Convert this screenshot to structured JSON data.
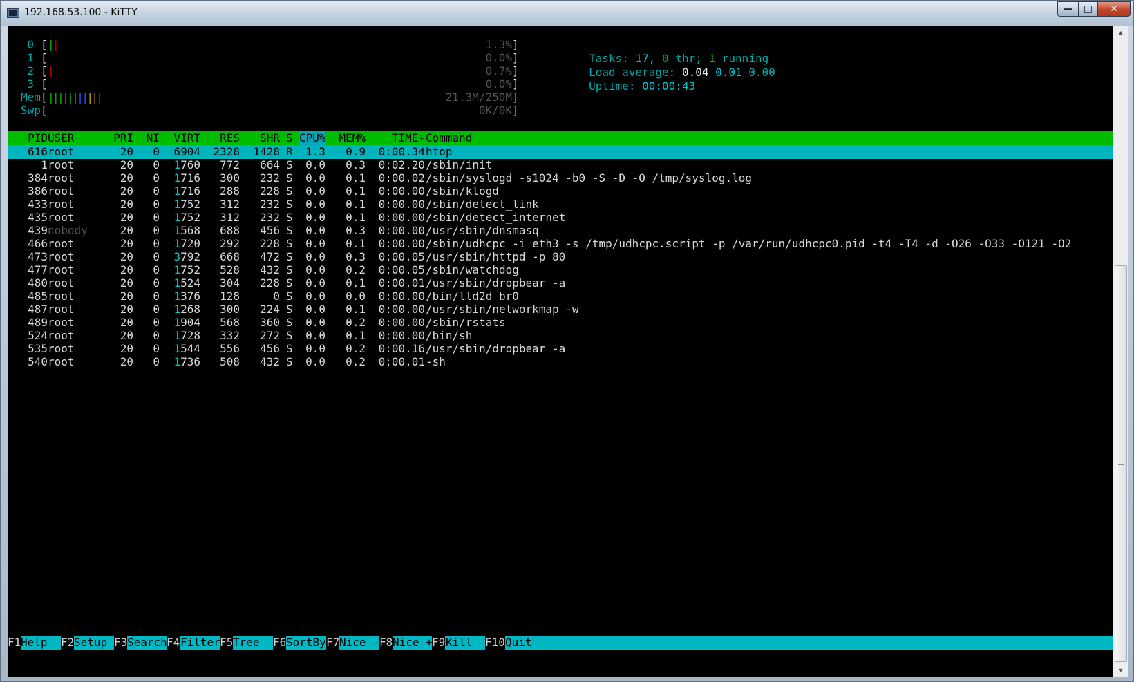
{
  "window": {
    "title": "192.168.53.100 - KiTTY"
  },
  "meters": {
    "cpus": [
      {
        "label": "0",
        "percent": "1.3%",
        "bars": [
          {
            "ch": "|",
            "color": "green"
          },
          {
            "ch": "|",
            "color": "red"
          }
        ]
      },
      {
        "label": "1",
        "percent": "0.0%",
        "bars": []
      },
      {
        "label": "2",
        "percent": "0.7%",
        "bars": [
          {
            "ch": "|",
            "color": "red"
          }
        ]
      },
      {
        "label": "3",
        "percent": "0.0%",
        "bars": []
      }
    ],
    "mem": {
      "label": "Mem",
      "value": "21.3M/250M"
    },
    "swp": {
      "label": "Swp",
      "value": "0K/0K"
    }
  },
  "summary": {
    "tasks_label": "Tasks:",
    "tasks_count": "17,",
    "threads_count": "0",
    "threads_label": "thr;",
    "running_count": "1",
    "running_label": "running",
    "load_label": "Load average:",
    "load_1": "0.04",
    "load_5": "0.01",
    "load_15": "0.00",
    "uptime_label": "Uptime:",
    "uptime_value": "00:00:43"
  },
  "table": {
    "columns": {
      "pid": "PID",
      "user": "USER",
      "pri": "PRI",
      "ni": "NI",
      "virt": "VIRT",
      "res": "RES",
      "shr": "SHR",
      "s": "S",
      "cpu": "CPU%",
      "mem": "MEM%",
      "time": "TIME+",
      "command": "Command"
    },
    "rows": [
      {
        "pid": "616",
        "user": "root",
        "pri": "20",
        "ni": "0",
        "virt": "6904",
        "res": "2328",
        "shr": "1428",
        "s": "R",
        "cpu": "1.3",
        "mem": "0.9",
        "time": "0:00.34",
        "command": "htop",
        "selected": true
      },
      {
        "pid": "1",
        "user": "root",
        "pri": "20",
        "ni": "0",
        "virt": "1760",
        "res": "772",
        "shr": "664",
        "s": "S",
        "cpu": "0.0",
        "mem": "0.3",
        "time": "0:02.20",
        "command": "/sbin/init"
      },
      {
        "pid": "384",
        "user": "root",
        "pri": "20",
        "ni": "0",
        "virt": "1716",
        "res": "300",
        "shr": "232",
        "s": "S",
        "cpu": "0.0",
        "mem": "0.1",
        "time": "0:00.02",
        "command": "/sbin/syslogd -s1024 -b0 -S -D -O /tmp/syslog.log"
      },
      {
        "pid": "386",
        "user": "root",
        "pri": "20",
        "ni": "0",
        "virt": "1716",
        "res": "288",
        "shr": "228",
        "s": "S",
        "cpu": "0.0",
        "mem": "0.1",
        "time": "0:00.00",
        "command": "/sbin/klogd"
      },
      {
        "pid": "433",
        "user": "root",
        "pri": "20",
        "ni": "0",
        "virt": "1752",
        "res": "312",
        "shr": "232",
        "s": "S",
        "cpu": "0.0",
        "mem": "0.1",
        "time": "0:00.00",
        "command": "/sbin/detect_link"
      },
      {
        "pid": "435",
        "user": "root",
        "pri": "20",
        "ni": "0",
        "virt": "1752",
        "res": "312",
        "shr": "232",
        "s": "S",
        "cpu": "0.0",
        "mem": "0.1",
        "time": "0:00.00",
        "command": "/sbin/detect_internet"
      },
      {
        "pid": "439",
        "user": "nobody",
        "pri": "20",
        "ni": "0",
        "virt": "1568",
        "res": "688",
        "shr": "456",
        "s": "S",
        "cpu": "0.0",
        "mem": "0.3",
        "time": "0:00.00",
        "command": "/usr/sbin/dnsmasq"
      },
      {
        "pid": "466",
        "user": "root",
        "pri": "20",
        "ni": "0",
        "virt": "1720",
        "res": "292",
        "shr": "228",
        "s": "S",
        "cpu": "0.0",
        "mem": "0.1",
        "time": "0:00.00",
        "command": "/sbin/udhcpc -i eth3 -s /tmp/udhcpc.script -p /var/run/udhcpc0.pid -t4 -T4 -d -O26 -O33 -O121 -O2"
      },
      {
        "pid": "473",
        "user": "root",
        "pri": "20",
        "ni": "0",
        "virt": "3792",
        "res": "668",
        "shr": "472",
        "s": "S",
        "cpu": "0.0",
        "mem": "0.3",
        "time": "0:00.05",
        "command": "/usr/sbin/httpd -p 80"
      },
      {
        "pid": "477",
        "user": "root",
        "pri": "20",
        "ni": "0",
        "virt": "1752",
        "res": "528",
        "shr": "432",
        "s": "S",
        "cpu": "0.0",
        "mem": "0.2",
        "time": "0:00.05",
        "command": "/sbin/watchdog"
      },
      {
        "pid": "480",
        "user": "root",
        "pri": "20",
        "ni": "0",
        "virt": "1524",
        "res": "304",
        "shr": "228",
        "s": "S",
        "cpu": "0.0",
        "mem": "0.1",
        "time": "0:00.01",
        "command": "/usr/sbin/dropbear -a"
      },
      {
        "pid": "485",
        "user": "root",
        "pri": "20",
        "ni": "0",
        "virt": "1376",
        "res": "128",
        "shr": "0",
        "s": "S",
        "cpu": "0.0",
        "mem": "0.0",
        "time": "0:00.00",
        "command": "/bin/lld2d br0"
      },
      {
        "pid": "487",
        "user": "root",
        "pri": "20",
        "ni": "0",
        "virt": "1268",
        "res": "300",
        "shr": "224",
        "s": "S",
        "cpu": "0.0",
        "mem": "0.1",
        "time": "0:00.00",
        "command": "/usr/sbin/networkmap -w"
      },
      {
        "pid": "489",
        "user": "root",
        "pri": "20",
        "ni": "0",
        "virt": "1904",
        "res": "568",
        "shr": "360",
        "s": "S",
        "cpu": "0.0",
        "mem": "0.2",
        "time": "0:00.00",
        "command": "/sbin/rstats"
      },
      {
        "pid": "524",
        "user": "root",
        "pri": "20",
        "ni": "0",
        "virt": "1728",
        "res": "332",
        "shr": "272",
        "s": "S",
        "cpu": "0.0",
        "mem": "0.1",
        "time": "0:00.00",
        "command": "/bin/sh"
      },
      {
        "pid": "535",
        "user": "root",
        "pri": "20",
        "ni": "0",
        "virt": "1544",
        "res": "556",
        "shr": "456",
        "s": "S",
        "cpu": "0.0",
        "mem": "0.2",
        "time": "0:00.16",
        "command": "/usr/sbin/dropbear -a"
      },
      {
        "pid": "540",
        "user": "root",
        "pri": "20",
        "ni": "0",
        "virt": "1736",
        "res": "508",
        "shr": "432",
        "s": "S",
        "cpu": "0.0",
        "mem": "0.2",
        "time": "0:00.01",
        "command": "-sh"
      }
    ]
  },
  "function_keys": [
    {
      "key": "F1",
      "label": "Help  "
    },
    {
      "key": "F2",
      "label": "Setup "
    },
    {
      "key": "F3",
      "label": "Search"
    },
    {
      "key": "F4",
      "label": "Filter"
    },
    {
      "key": "F5",
      "label": "Tree  "
    },
    {
      "key": "F6",
      "label": "SortBy"
    },
    {
      "key": "F7",
      "label": "Nice -"
    },
    {
      "key": "F8",
      "label": "Nice +"
    },
    {
      "key": "F9",
      "label": "Kill  "
    },
    {
      "key": "F10",
      "label": "Quit"
    }
  ],
  "colors": {
    "header_bg": "#00bc00",
    "selected_bg": "#00b4bd",
    "fkey_bg": "#00b8c4",
    "accent_cyan": "#00aaaa"
  }
}
